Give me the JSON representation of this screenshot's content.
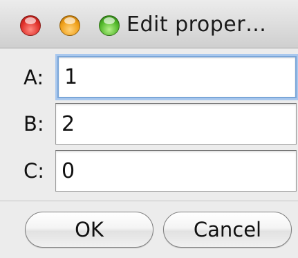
{
  "window": {
    "title": "Edit proper…"
  },
  "fields": [
    {
      "label": "A:",
      "value": "1"
    },
    {
      "label": "B:",
      "value": "2"
    },
    {
      "label": "C:",
      "value": "0"
    }
  ],
  "buttons": {
    "ok": "OK",
    "cancel": "Cancel"
  },
  "colors": {
    "focus_ring": "#7aa6d8",
    "close": "#e0302a",
    "minimize": "#f0a019",
    "zoom": "#52b82a"
  }
}
